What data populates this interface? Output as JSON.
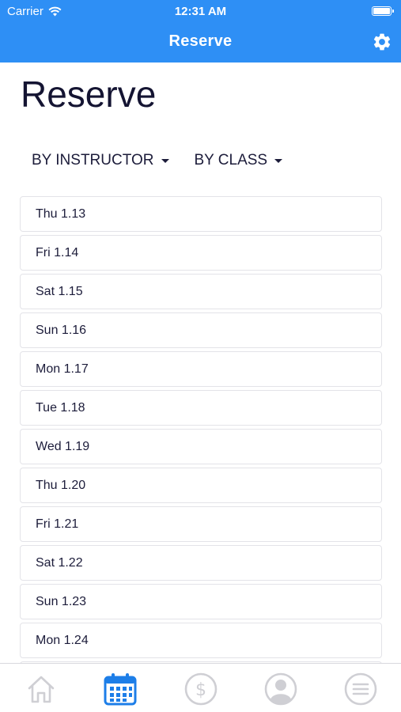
{
  "status_bar": {
    "carrier": "Carrier",
    "time": "12:31 AM"
  },
  "nav": {
    "title": "Reserve",
    "settings_icon": "gear-icon"
  },
  "page": {
    "title": "Reserve"
  },
  "filters": [
    {
      "label": "BY INSTRUCTOR"
    },
    {
      "label": "BY CLASS"
    }
  ],
  "dates": [
    "Thu 1.13",
    "Fri 1.14",
    "Sat 1.15",
    "Sun 1.16",
    "Mon 1.17",
    "Tue 1.18",
    "Wed 1.19",
    "Thu 1.20",
    "Fri 1.21",
    "Sat 1.22",
    "Sun 1.23",
    "Mon 1.24",
    ""
  ],
  "tabs": [
    {
      "icon": "home-icon",
      "active": false
    },
    {
      "icon": "calendar-icon",
      "active": true
    },
    {
      "icon": "dollar-icon",
      "active": false
    },
    {
      "icon": "profile-icon",
      "active": false
    },
    {
      "icon": "menu-icon",
      "active": false
    }
  ],
  "colors": {
    "brand": "#2e8ff5",
    "active_tab": "#1d7ee8",
    "inactive_tab": "#cfcfd4",
    "text": "#1c1c3a"
  }
}
